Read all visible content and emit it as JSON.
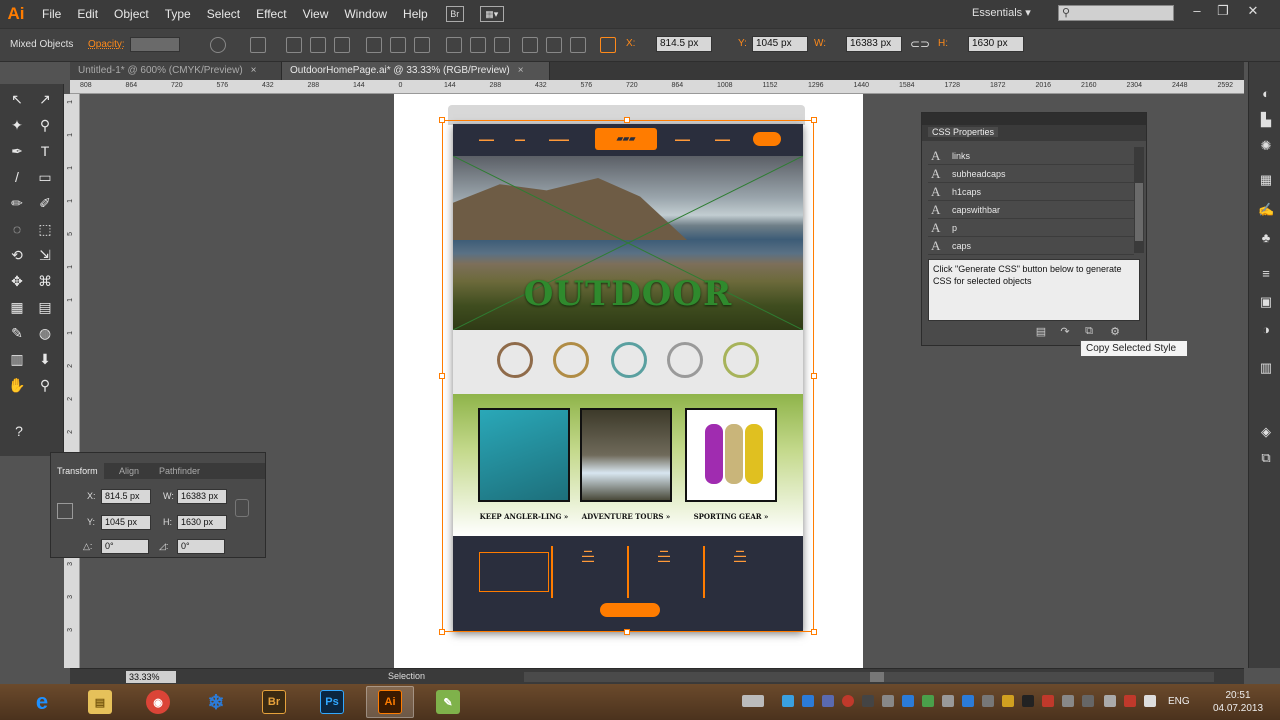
{
  "app": {
    "logo": "Ai",
    "menus": [
      "File",
      "Edit",
      "Object",
      "Type",
      "Select",
      "Effect",
      "View",
      "Window",
      "Help"
    ],
    "bridge_box": "Br",
    "workspace": "Essentials",
    "workspace_arrow": "▾",
    "search_placeholder": "",
    "window_controls": [
      "–",
      "❐",
      "✕"
    ]
  },
  "control_bar": {
    "selection_label": "Mixed Objects",
    "opacity_label": "Opacity:",
    "x_label": "X:",
    "x_value": "814.5 px",
    "y_label": "Y:",
    "y_value": "1045 px",
    "w_label": "W:",
    "w_value": "16383 px",
    "h_label": "H:",
    "h_value": "1630 px"
  },
  "tabs": [
    {
      "label": "Untitled-1* @ 600% (CMYK/Preview)",
      "close": "×"
    },
    {
      "label": "OutdoorHomePage.ai* @ 33.33% (RGB/Preview)",
      "close": "×"
    }
  ],
  "ruler_top": [
    "808",
    "864",
    "720",
    "576",
    "432",
    "288",
    "144",
    "0",
    "144",
    "288",
    "432",
    "576",
    "720",
    "864",
    "1008",
    "1152",
    "1296",
    "1440",
    "1584",
    "1728",
    "1872",
    "2016",
    "2160",
    "2304",
    "2448",
    "2592"
  ],
  "ruler_left": [
    "1",
    "1",
    "1",
    "1",
    "5",
    "1",
    "1",
    "1",
    "2",
    "2",
    "2",
    "2",
    "2",
    "3",
    "3",
    "3",
    "3"
  ],
  "tools": [
    "↖",
    "↗",
    "✦",
    "⚲",
    "✒",
    "T",
    "/",
    "▭",
    "✏",
    "✐",
    "◌",
    "⬚",
    "⟲",
    "⇲",
    "✥",
    "⌘",
    "▦",
    "▤",
    "✎",
    "◍",
    "▥",
    "⬇",
    "✋",
    "⚲",
    "?"
  ],
  "transform_panel": {
    "tabs": [
      "Transform",
      "Align",
      "Pathfinder"
    ],
    "x_label": "X:",
    "x_value": "814.5 px",
    "w_label": "W:",
    "w_value": "16383 px",
    "y_label": "Y:",
    "y_value": "1045 px",
    "h_label": "H:",
    "h_value": "1630 px",
    "angle_label": "△:",
    "angle_value": "0°",
    "shear_label": "◿:",
    "shear_value": "0°"
  },
  "artboard": {
    "hero_title": "OUTDOOR",
    "card_captions": [
      "KEEP ANGLER-LING »",
      "ADVENTURE TOURS »",
      "SPORTING GEAR »"
    ],
    "icon_colors": [
      "#8f6b4a",
      "#b08c45",
      "#5aa0a0",
      "#9a9a9a",
      "#a7b35a"
    ]
  },
  "css_panel": {
    "title": "CSS Properties",
    "styles": [
      "links",
      "subheadcaps",
      "h1caps",
      "capswithbar",
      "p",
      "caps"
    ],
    "style_glyph": "A",
    "note": "Click \"Generate CSS\" button below to generate CSS for selected objects",
    "tooltip": "Copy Selected Style"
  },
  "status_bar": {
    "zoom": "33.33%",
    "status": "Selection"
  },
  "taskbar": {
    "apps": [
      {
        "name": "Internet Explorer",
        "glyph": "e",
        "color": "#1e90ff"
      },
      {
        "name": "File Explorer",
        "glyph": "▤",
        "color": "#e6c15a"
      },
      {
        "name": "Chrome",
        "glyph": "◉",
        "color": "#db4437"
      },
      {
        "name": "Snowflake app",
        "glyph": "❄",
        "color": "#2b7bd8"
      },
      {
        "name": "Bridge",
        "glyph": "Br",
        "color": "#3b2a12"
      },
      {
        "name": "Photoshop",
        "glyph": "Ps",
        "color": "#0b2640"
      },
      {
        "name": "Illustrator",
        "glyph": "Ai",
        "color": "#3b1a00"
      },
      {
        "name": "Notepad app",
        "glyph": "✎",
        "color": "#7fb24b"
      }
    ],
    "lang": "ENG",
    "time": "20:51",
    "date": "04.07.2013"
  }
}
